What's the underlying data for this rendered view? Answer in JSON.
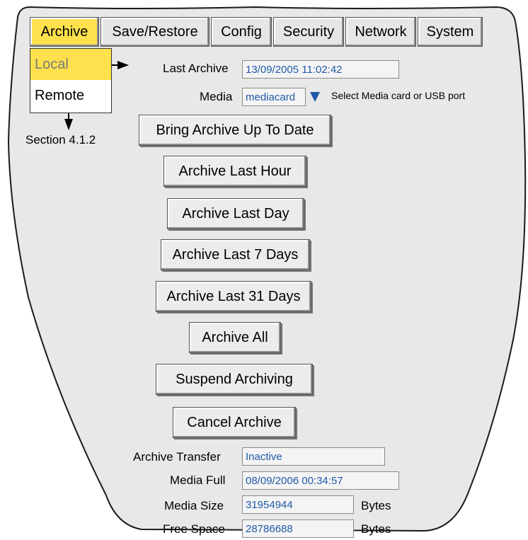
{
  "tabs": [
    "Archive",
    "Save/Restore",
    "Config",
    "Security",
    "Network",
    "System"
  ],
  "dropdown": {
    "local": "Local",
    "remote": "Remote"
  },
  "section_note": "Section 4.1.2",
  "last_archive": {
    "label": "Last Archive",
    "value": "13/09/2005 11:02:42"
  },
  "media": {
    "label": "Media",
    "value": "mediacard",
    "hint": "Select Media card or USB port"
  },
  "buttons": {
    "bring_up_to_date": "Bring Archive Up To Date",
    "last_hour": "Archive Last Hour",
    "last_day": "Archive Last Day",
    "last_7_days": "Archive Last 7 Days",
    "last_31_days": "Archive Last 31 Days",
    "all": "Archive All",
    "suspend": "Suspend Archiving",
    "cancel": "Cancel Archive"
  },
  "status": {
    "transfer_label": "Archive Transfer",
    "transfer_value": "Inactive",
    "media_full_label": "Media Full",
    "media_full_value": "08/09/2006 00:34:57",
    "media_size_label": "Media Size",
    "media_size_value": "31954944",
    "media_size_unit": "Bytes",
    "free_space_label": "Free Space",
    "free_space_value": "28786688",
    "free_space_unit": "Bytes"
  },
  "colors": {
    "active_tab": "#ffe14d",
    "field_text": "#1f5aa8",
    "panel": "#e8e8e8"
  }
}
